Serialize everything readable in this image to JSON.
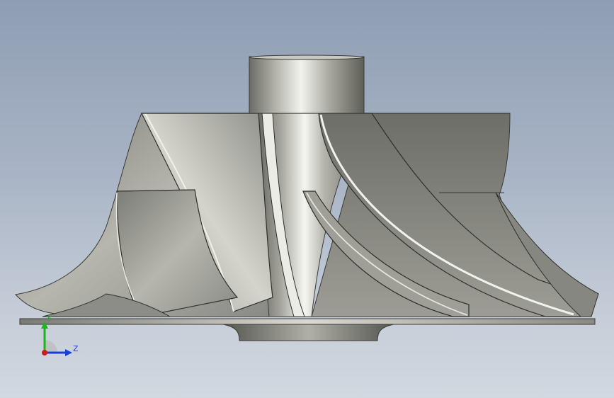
{
  "viewport": {
    "background_top": "#8f9db3",
    "background_bottom": "#d2d8e0"
  },
  "model": {
    "name": "impeller",
    "metal_light": "#e9e9e2",
    "metal_mid": "#a3a39c",
    "metal_dark": "#5d5d57"
  },
  "triad": {
    "y_label": "Y",
    "z_label": "Z",
    "y_color": "#1db51d",
    "z_color": "#1a3fd6",
    "x_color": "#d11a1a"
  }
}
